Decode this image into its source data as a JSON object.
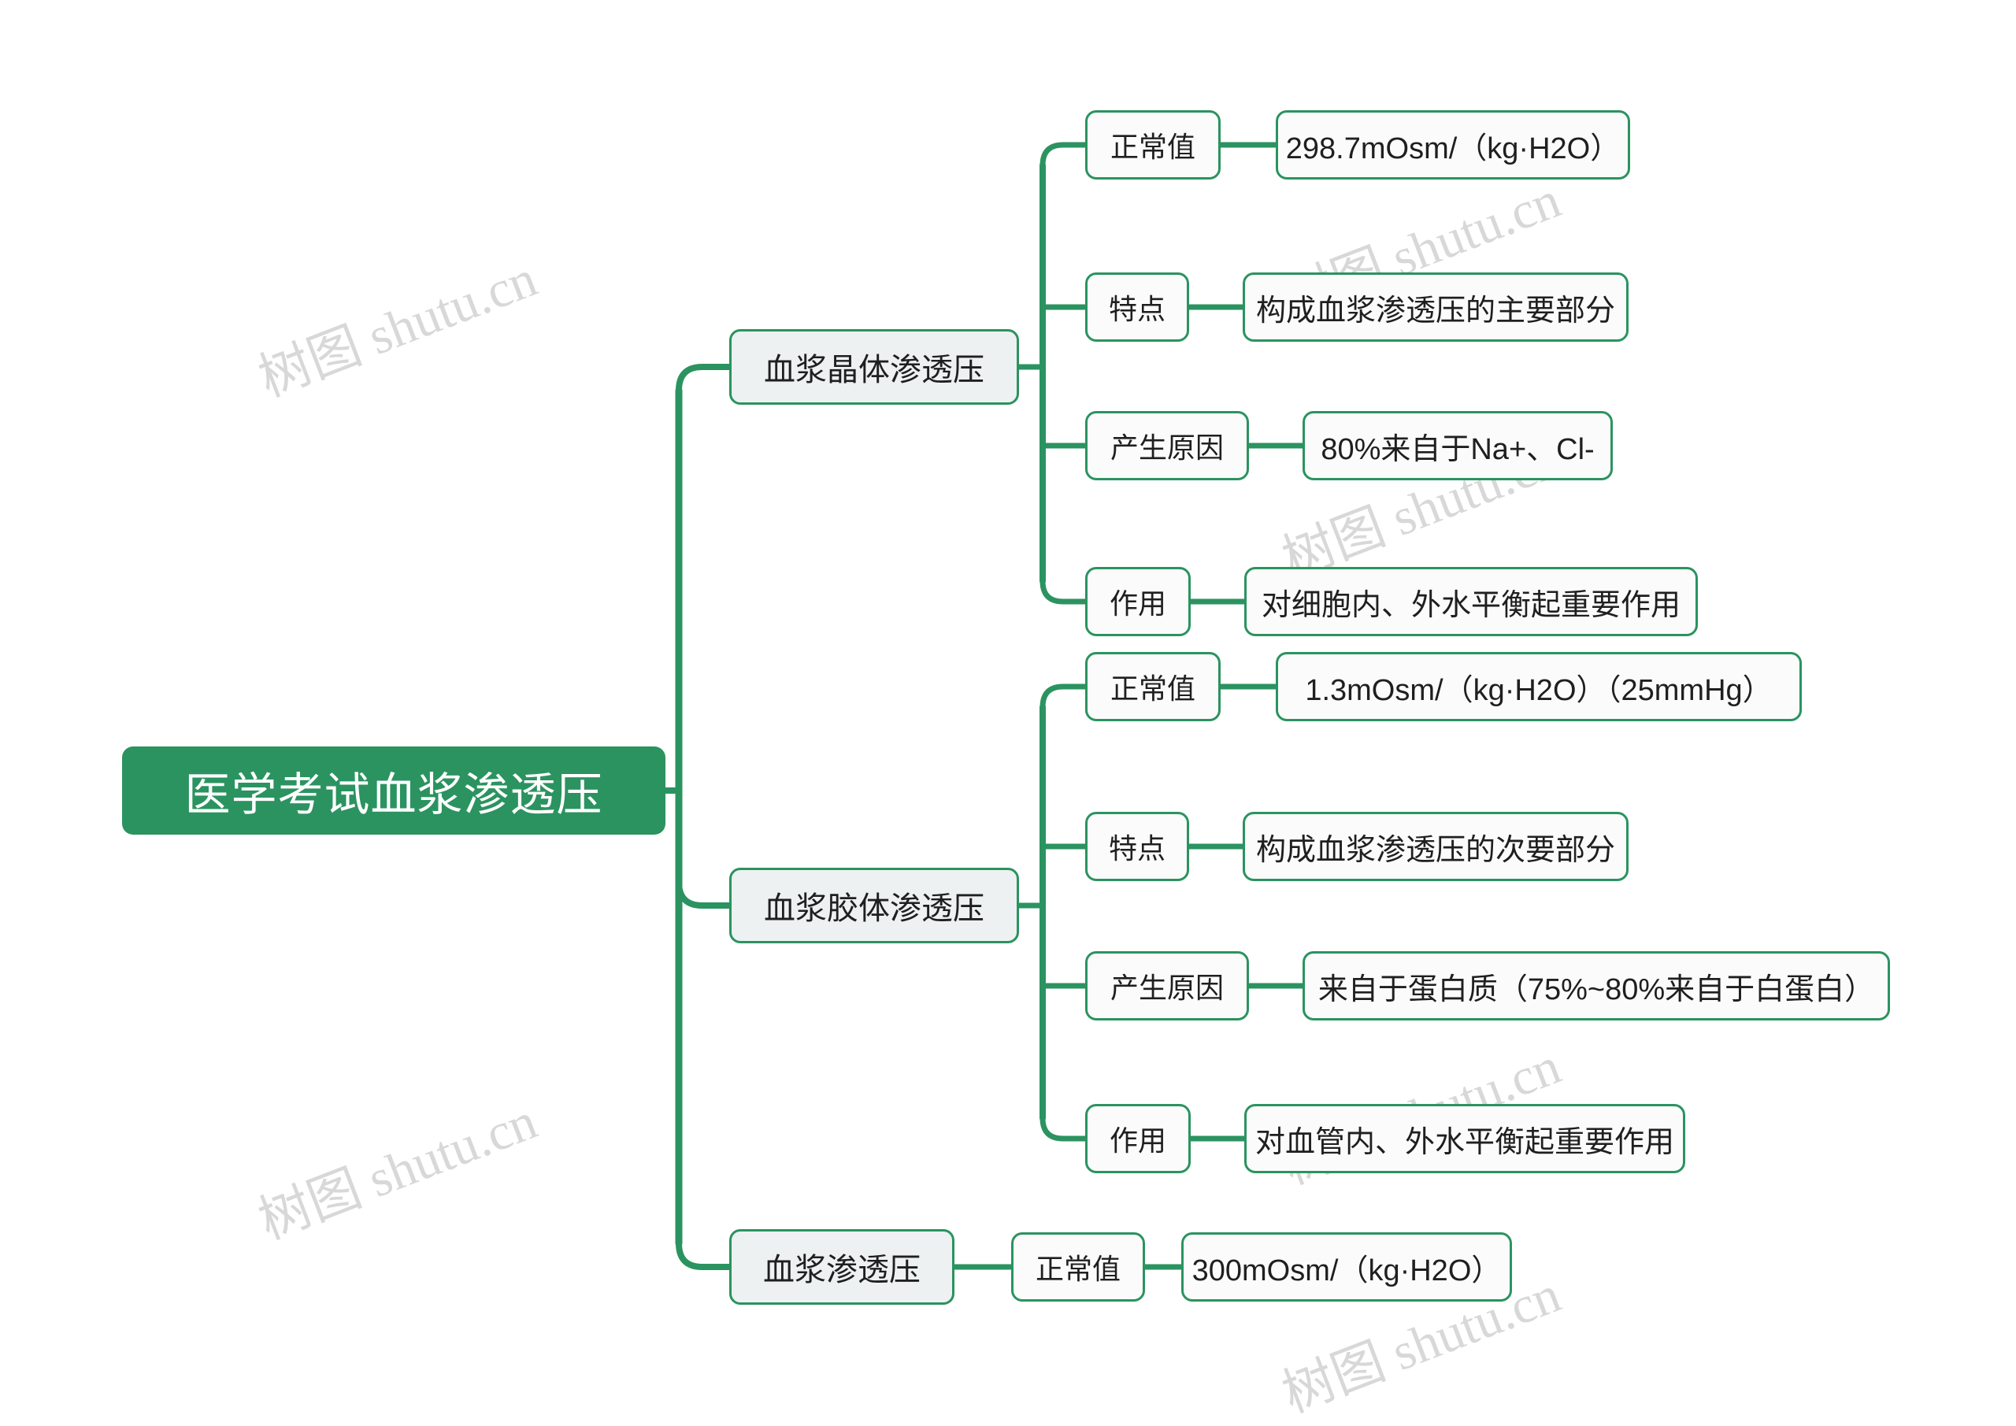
{
  "theme": {
    "accent": "#2b9360",
    "root_text": "#ffffff",
    "branch_fill": "#edf1f2",
    "leaf_fill": "#fbfbfb",
    "text": "#1f1f1f",
    "background": "#ffffff",
    "watermark_color": "#d8d8d8"
  },
  "watermark": {
    "text": "树图 shutu.cn"
  },
  "mindmap": {
    "root": {
      "label": "医学考试血浆渗透压"
    },
    "branches": [
      {
        "label": "血浆晶体渗透压",
        "children": [
          {
            "label": "正常值",
            "value": "298.7mOsm/（kg·H2O）"
          },
          {
            "label": "特点",
            "value": "构成血浆渗透压的主要部分"
          },
          {
            "label": "产生原因",
            "value": "80%来自于Na+、Cl-"
          },
          {
            "label": "作用",
            "value": "对细胞内、外水平衡起重要作用"
          }
        ]
      },
      {
        "label": "血浆胶体渗透压",
        "children": [
          {
            "label": "正常值",
            "value": "1.3mOsm/（kg·H2O）（25mmHg）"
          },
          {
            "label": "特点",
            "value": "构成血浆渗透压的次要部分"
          },
          {
            "label": "产生原因",
            "value": "来自于蛋白质（75%~80%来自于白蛋白）"
          },
          {
            "label": "作用",
            "value": "对血管内、外水平衡起重要作用"
          }
        ]
      },
      {
        "label": "血浆渗透压",
        "children": [
          {
            "label": "正常值",
            "value": "300mOsm/（kg·H2O）"
          }
        ]
      }
    ]
  }
}
